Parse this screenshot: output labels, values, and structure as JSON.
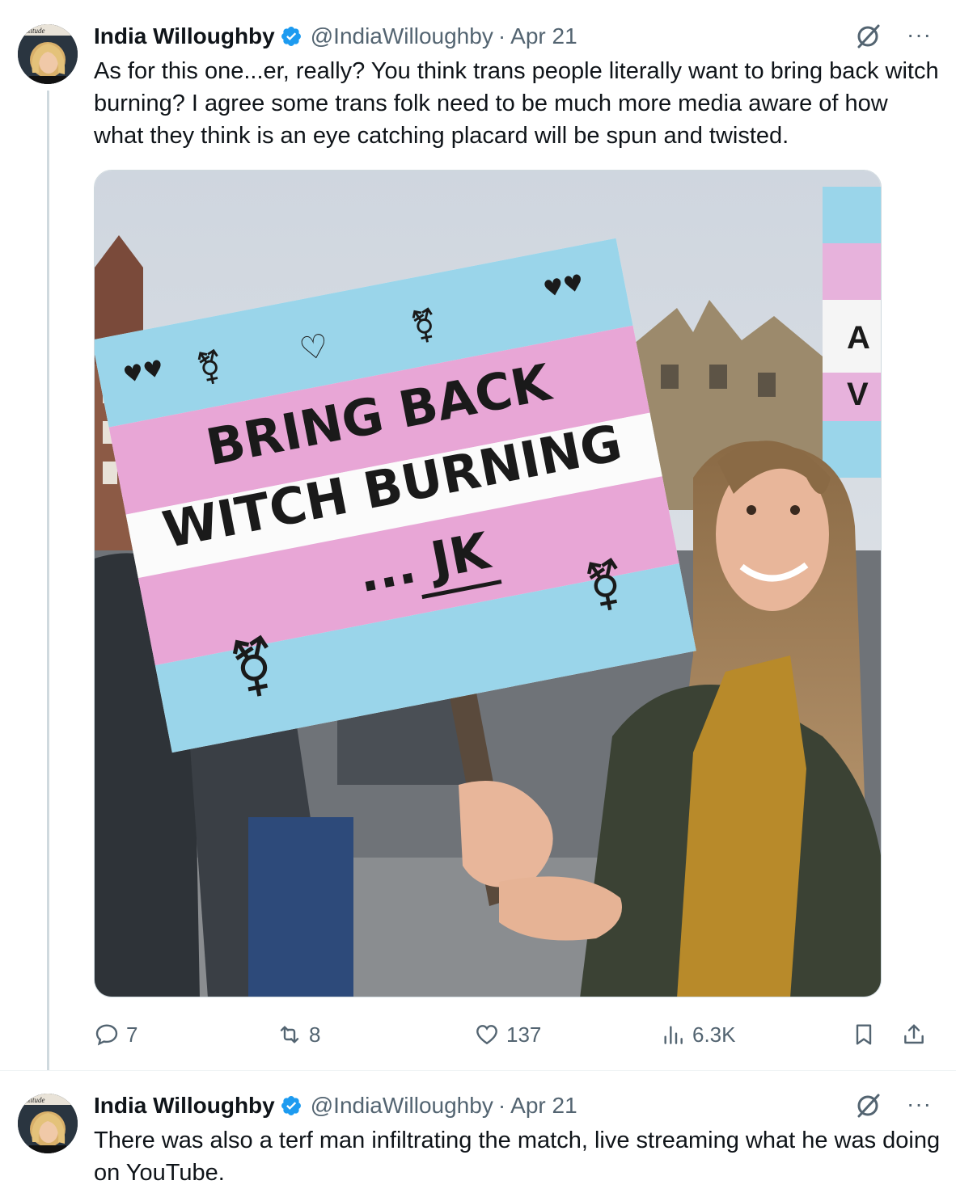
{
  "tweets": [
    {
      "author_name": "India Willoughby",
      "handle": "@IndiaWilloughby",
      "separator": "·",
      "date": "Apr 21",
      "avatar_brand": "attitude",
      "text": "As for this one...er, really? You think trans people literally want to bring back witch burning? I agree some trans folk need to be much more media aware of how what they think is an eye catching placard will be spun and twisted.",
      "image": {
        "sign_line1": "BRING BACK",
        "sign_line2": "WITCH BURNING",
        "sign_line3": "... JK",
        "second_sign_fragment": "A V"
      },
      "actions": {
        "replies": "7",
        "reposts": "8",
        "likes": "137",
        "views": "6.3K"
      },
      "more_label": "···"
    },
    {
      "author_name": "India Willoughby",
      "handle": "@IndiaWilloughby",
      "separator": "·",
      "date": "Apr 21",
      "avatar_brand": "attitude",
      "text": "There was also a terf man infiltrating the match, live streaming what he was doing on YouTube.",
      "more_label": "···"
    }
  ],
  "colors": {
    "verified": "#1d9bf0",
    "secondary_text": "#536471",
    "thread_line": "#cfd9de",
    "trans_blue": "#8fd3ec",
    "trans_pink": "#e8a6d6"
  },
  "icons": [
    "grok-icon",
    "more-icon",
    "reply-icon",
    "repost-icon",
    "like-icon",
    "views-icon",
    "bookmark-icon",
    "share-icon",
    "verified-icon"
  ]
}
